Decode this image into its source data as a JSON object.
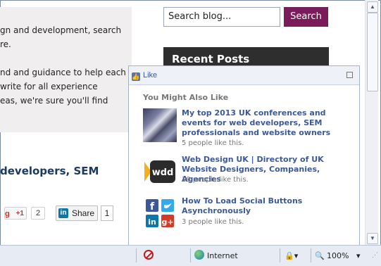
{
  "page": {
    "intro_lines": [
      "gn and development, search",
      "re.",
      "nd and guidance to help each of",
      "write for all experience",
      "eas, we're sure you'll find"
    ],
    "heading": "developers, SEM"
  },
  "search": {
    "placeholder": "Search blog...",
    "button_label": "Search"
  },
  "sidebar": {
    "recent_posts_title": "Recent Posts"
  },
  "share": {
    "gplus_label": "+1",
    "gplus_count": "2",
    "linkedin_label": "Share",
    "linkedin_count": "1"
  },
  "fb_popup": {
    "like_label": "Like",
    "section_title": "You Might Also Like",
    "items": [
      {
        "title": "My top 2013 UK conferences and events for web developers, SEM professionals and website owners",
        "likes": "5 people like this.",
        "thumb": "conference-photo"
      },
      {
        "title": "Web Design UK | Directory of UK Website Designers, Companies, Agencies",
        "likes": "19 people like this.",
        "thumb": "wdd-logo"
      },
      {
        "title": "How To Load Social Buttons Asynchronously",
        "likes": "3 people like this.",
        "thumb": "social-buttons-icon"
      }
    ]
  },
  "statusbar": {
    "zone": "Internet",
    "zoom": "100%"
  },
  "colors": {
    "search_button": "#7b1c5a",
    "fb_link": "#3b5998",
    "heading": "#1b3a63"
  }
}
